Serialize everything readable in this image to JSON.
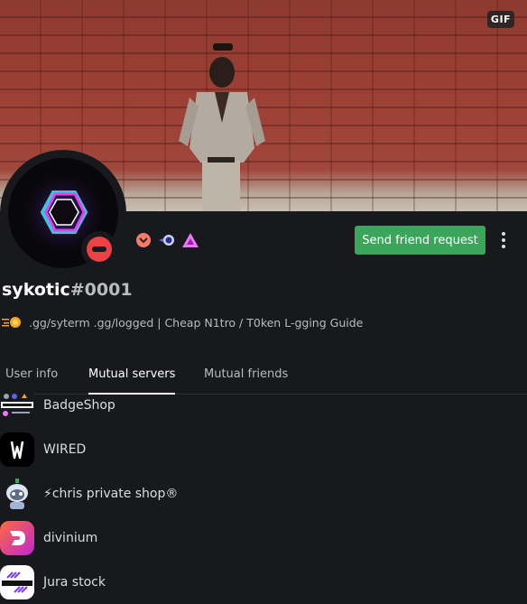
{
  "banner": {
    "badge": "GIF"
  },
  "profile": {
    "username": "sykotic",
    "discriminator": "#0001",
    "custom_status": ".gg/syterm .gg/logged | Cheap N1tro / T0ken L-gging Guide",
    "status": "do-not-disturb",
    "badges": [
      "boost-badge",
      "hypesquad-badge",
      "early-supporter-badge"
    ]
  },
  "actions": {
    "friend_request": "Send friend request"
  },
  "tabs": [
    {
      "label": "User info",
      "active": false
    },
    {
      "label": "Mutual servers",
      "active": true
    },
    {
      "label": "Mutual friends",
      "active": false
    }
  ],
  "servers": [
    {
      "name": "BadgeShop",
      "icon": "badgeshop-icon"
    },
    {
      "name": "WIRED",
      "icon": "wired-icon"
    },
    {
      "name": "chris private shop®",
      "icon": "chris-shop-icon",
      "prefix": "⚡"
    },
    {
      "name": "divinium",
      "icon": "divinium-icon"
    },
    {
      "name": "Jura stock",
      "icon": "jura-stock-icon"
    }
  ],
  "colors": {
    "accent_green": "#3ba55c",
    "dnd_red": "#ed4245",
    "background": "#18191c"
  }
}
